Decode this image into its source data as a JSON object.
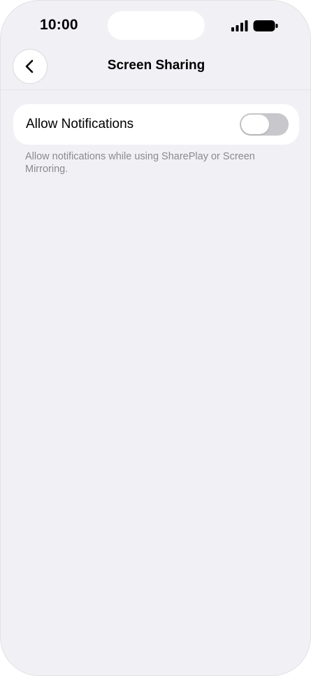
{
  "status_bar": {
    "time": "10:00",
    "signal_icon": "cellular-signal-icon",
    "battery_icon": "battery-full-icon"
  },
  "nav": {
    "back_icon": "chevron-left-icon",
    "title": "Screen Sharing"
  },
  "settings": {
    "allow_notifications": {
      "label": "Allow Notifications",
      "enabled": false
    },
    "footnote": "Allow notifications while using SharePlay or Screen Mirroring."
  },
  "colors": {
    "background": "#f1f0f5",
    "card": "#ffffff",
    "toggle_off": "#c8c8cc",
    "footnote_text": "#8a8a8f"
  }
}
